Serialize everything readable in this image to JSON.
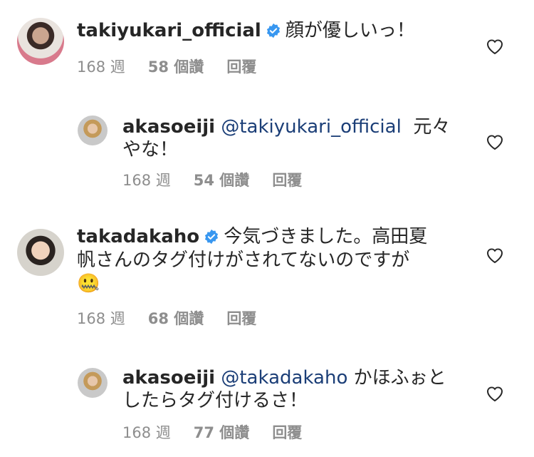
{
  "comments": [
    {
      "username": "takiyukari_official",
      "verified": true,
      "mention": "",
      "text": "顔が優しいっ！",
      "time": "168 週",
      "likes": "58 個讚",
      "reply": "回覆"
    },
    {
      "username": "akasoeiji",
      "verified": false,
      "mention": "@takiyukari_official",
      "text_line1": "元々",
      "text_line2": "やな！",
      "time": "168 週",
      "likes": "54 個讚",
      "reply": "回覆"
    },
    {
      "username": "takadakaho",
      "verified": true,
      "mention": "",
      "text_line1": "今気づきました。高田夏",
      "text_line2": "帆さんのタグ付けがされてないのですが",
      "emoji": "🤐",
      "time": "168 週",
      "likes": "68 個讚",
      "reply": "回覆"
    },
    {
      "username": "akasoeiji",
      "verified": false,
      "mention": "@takadakaho",
      "text_line1": "かほふぉと",
      "text_line2": "したらタグ付けるさ！",
      "time": "168 週",
      "likes": "77 個讚",
      "reply": "回覆"
    }
  ],
  "colors": {
    "verified_badge": "#3897f0",
    "mention": "#1b3e77",
    "meta": "#8e8e8e"
  },
  "icons": {
    "like": "heart-outline-icon",
    "verified": "verified-badge-icon"
  }
}
